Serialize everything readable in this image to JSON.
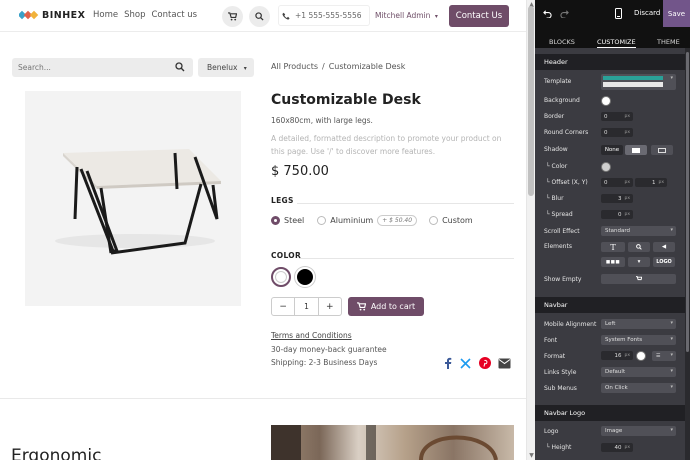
{
  "header": {
    "logo_text": "BINHEX",
    "nav": [
      "Home",
      "Shop",
      "Contact us"
    ],
    "phone": "+1 555-555-5556",
    "user": "Mitchell Admin",
    "contact_label": "Contact Us",
    "accent": "#6f4c68"
  },
  "search": {
    "placeholder": "Search...",
    "country": "Benelux"
  },
  "breadcrumb": {
    "root": "All Products",
    "sep": "/",
    "current": "Customizable Desk"
  },
  "product": {
    "title": "Customizable Desk",
    "subtitle": "160x80cm, with large legs.",
    "description": "A detailed, formatted description to promote your product on this page. Use '/' to discover more features.",
    "price": "$ 750.00",
    "legs_label": "LEGS",
    "legs": [
      {
        "label": "Steel",
        "selected": true
      },
      {
        "label": "Aluminium",
        "extra": "+ $ 50.40"
      },
      {
        "label": "Custom"
      }
    ],
    "color_label": "COLOR",
    "colors": [
      "#ffffff",
      "#000000"
    ],
    "qty": "1",
    "add_to_cart": "Add to cart",
    "terms": "Terms and Conditions",
    "guarantee": "30-day money-back guarantee",
    "shipping": "Shipping: 2-3 Business Days"
  },
  "section_heading": "Ergonomic",
  "editor": {
    "discard": "Discard",
    "save": "Save",
    "tabs": [
      "BLOCKS",
      "CUSTOMIZE",
      "THEME"
    ],
    "header_section": "Header",
    "template": "Template",
    "background": "Background",
    "border": "Border",
    "border_val": "0",
    "round_corners": "Round Corners",
    "round_val": "0",
    "shadow": "Shadow",
    "shadow_none": "None",
    "color": "└ Color",
    "offset": "└ Offset (X, Y)",
    "offset_x": "0",
    "offset_y": "1",
    "blur": "└ Blur",
    "blur_val": "3",
    "spread": "└ Spread",
    "spread_val": "0",
    "scroll_effect": "Scroll Effect",
    "scroll_val": "Standard",
    "elements": "Elements",
    "logo_btn": "LOGO",
    "show_empty": "Show Empty",
    "navbar_section": "Navbar",
    "mobile_alignment": "Mobile Alignment",
    "mobile_val": "Left",
    "font": "Font",
    "font_val": "System Fonts",
    "format": "Format",
    "format_size": "16",
    "links_style": "Links Style",
    "links_val": "Default",
    "sub_menus": "Sub Menus",
    "sub_val": "On Click",
    "navbar_logo_section": "Navbar Logo",
    "logo": "Logo",
    "logo_val": "Image",
    "height": "└ Height",
    "height_val": "40",
    "unit": "px"
  }
}
